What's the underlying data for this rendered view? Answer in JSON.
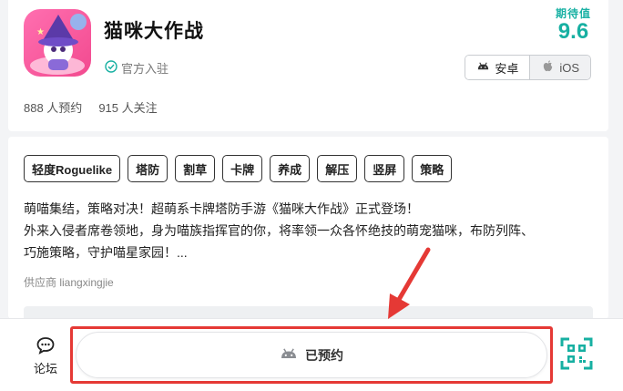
{
  "app": {
    "title": "猫咪大作战",
    "verified_label": "官方入驻",
    "icon_name": "app-icon-witch-cat"
  },
  "stats": {
    "reservations": "888 人预约",
    "followers": "915 人关注"
  },
  "score": {
    "label": "期待值",
    "value": "9.6"
  },
  "platforms": [
    {
      "label": "安卓",
      "icon": "android-icon",
      "selected": true
    },
    {
      "label": "iOS",
      "icon": "apple-icon",
      "selected": false
    }
  ],
  "tags": [
    "轻度Roguelike",
    "塔防",
    "割草",
    "卡牌",
    "养成",
    "解压",
    "竖屏",
    "策略"
  ],
  "description": {
    "line1": "萌喵集结，策略对决！超萌系卡牌塔防手游《猫咪大作战》正式登场！",
    "line2": "外来入侵者席卷领地，身为喵族指挥官的你，将率领一众各怀绝技的萌宠猫咪，布防列阵、",
    "line3": "巧施策略，守护喵星家园！..."
  },
  "supplier": "供应商 liangxingjie",
  "bottom": {
    "forum_label": "论坛",
    "reserve_label": "已预约",
    "qr_icon": "qr-code-icon"
  },
  "colors": {
    "accent": "#17b0a2",
    "highlight": "#e53935"
  }
}
